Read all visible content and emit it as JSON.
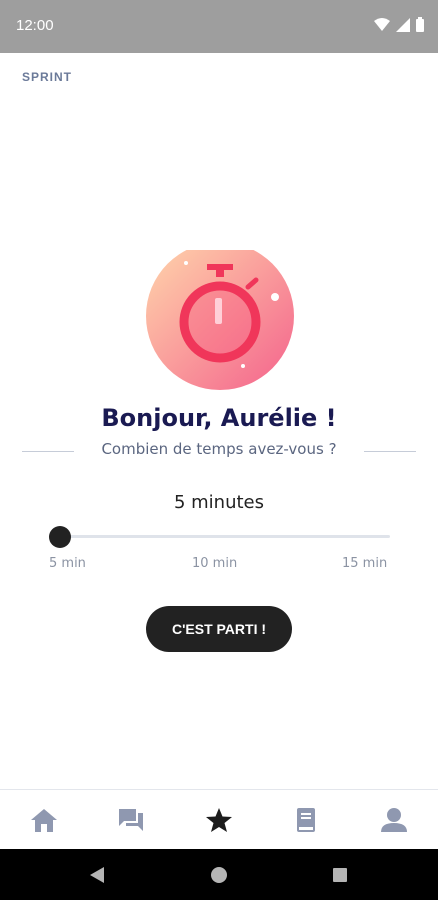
{
  "status_bar": {
    "time": "12:00"
  },
  "app": {
    "label": "SPRINT"
  },
  "main": {
    "greeting": "Bonjour, Aurélie !",
    "question": "Combien de temps avez-vous ?",
    "selected_duration": "5 minutes",
    "slider": {
      "value_minutes": 5,
      "min_minutes": 5,
      "max_minutes": 15
    },
    "ticks": [
      "5 min",
      "10 min",
      "15 min"
    ],
    "start_button": "C'EST PARTI !"
  },
  "bottom_nav": {
    "items": [
      {
        "icon": "home-icon",
        "active": false
      },
      {
        "icon": "chat-icon",
        "active": false
      },
      {
        "icon": "star-icon",
        "active": true
      },
      {
        "icon": "book-icon",
        "active": false
      },
      {
        "icon": "profile-icon",
        "active": false
      }
    ]
  },
  "colors": {
    "accent": "#f0365a",
    "gradient_start": "#ffd1a8",
    "gradient_end": "#f56a8e",
    "dark": "#222222",
    "title": "#1a1a52",
    "nav_inactive": "#8f98b0"
  }
}
